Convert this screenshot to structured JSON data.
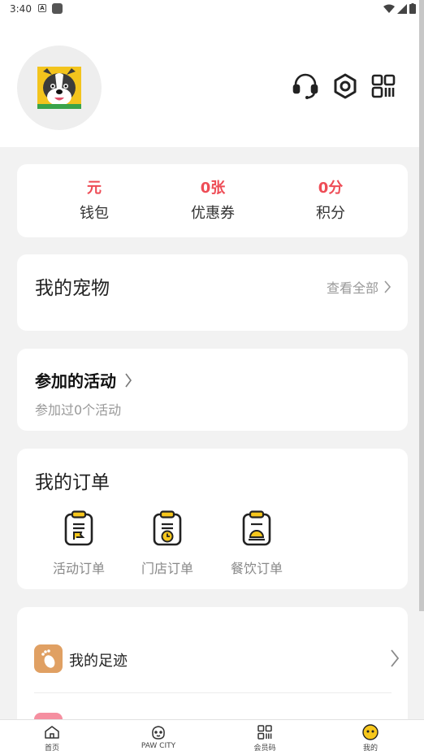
{
  "status_bar": {
    "time": "3:40"
  },
  "stats": [
    {
      "value": "元",
      "label": "钱包"
    },
    {
      "value": "0张",
      "label": "优惠券"
    },
    {
      "value": "0分",
      "label": "积分"
    }
  ],
  "pets": {
    "title": "我的宠物",
    "more": "查看全部"
  },
  "activities": {
    "title": "参加的活动",
    "subtitle": "参加过0个活动"
  },
  "orders": {
    "title": "我的订单",
    "items": [
      {
        "label": "活动订单",
        "icon": "activity-order-icon"
      },
      {
        "label": "门店订单",
        "icon": "store-order-icon"
      },
      {
        "label": "餐饮订单",
        "icon": "food-order-icon"
      }
    ]
  },
  "menu": {
    "footprint_label": "我的足迹"
  },
  "tabbar": [
    {
      "label": "首页",
      "icon": "home-icon"
    },
    {
      "label": "PAW CITY",
      "icon": "paw-city-icon"
    },
    {
      "label": "会员码",
      "icon": "member-code-icon"
    },
    {
      "label": "我的",
      "icon": "profile-icon"
    }
  ],
  "colors": {
    "accent": "#ee4c56",
    "icon_yellow": "#f7c71c",
    "footprint_icon_bg": "#e0a063"
  }
}
